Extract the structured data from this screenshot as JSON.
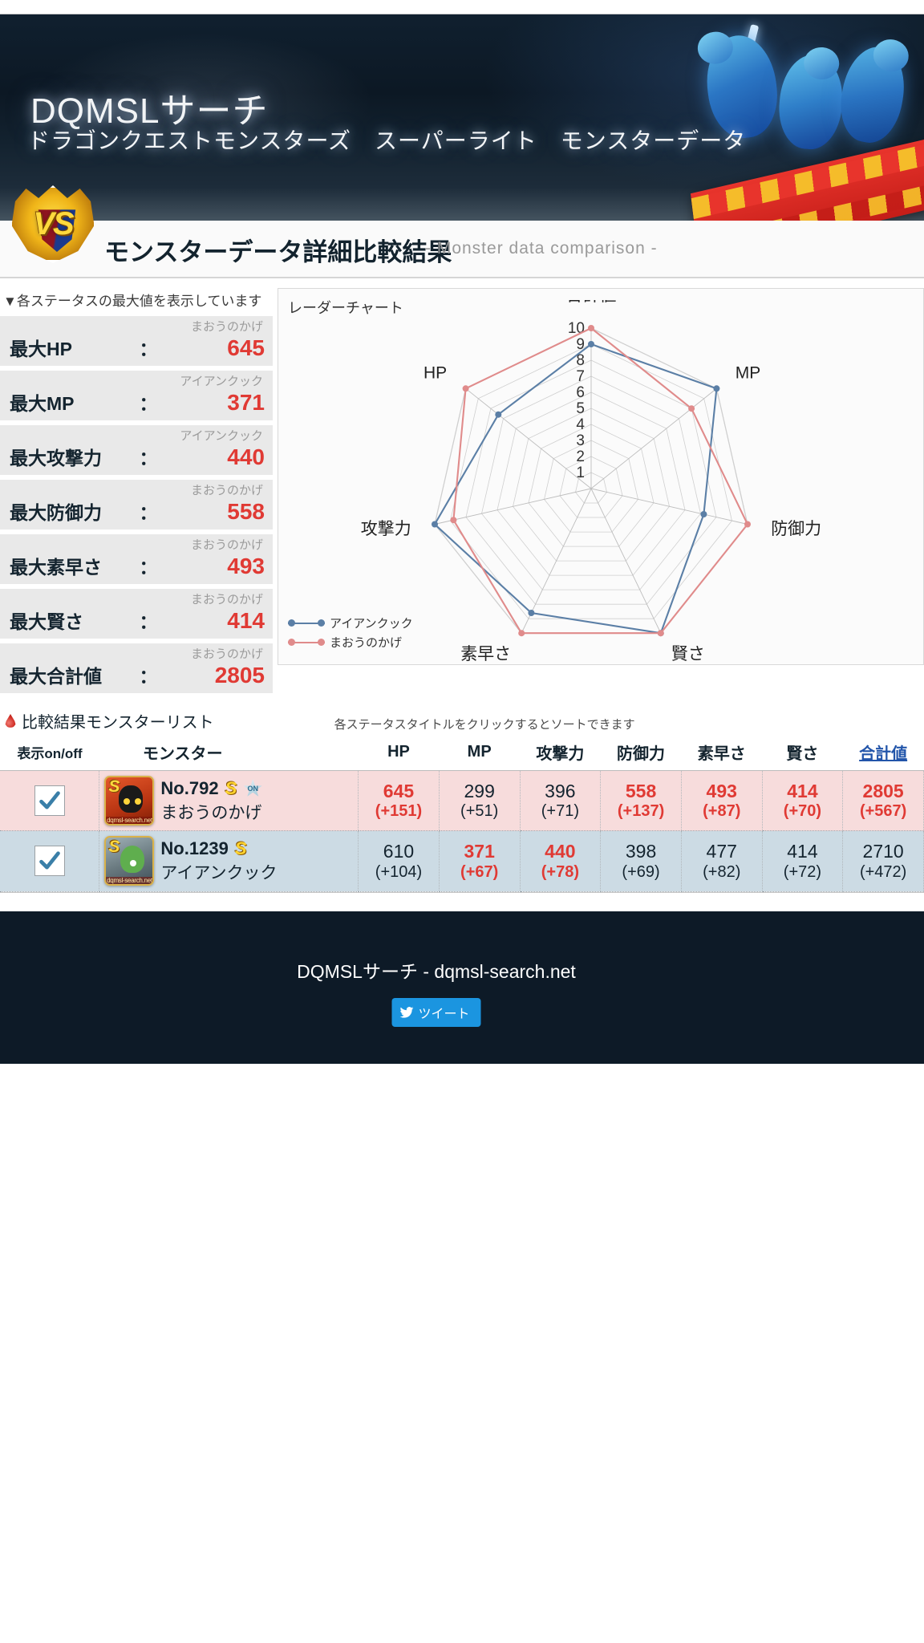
{
  "header": {
    "title": "DQMSLサーチ",
    "subtitle": "ドラゴンクエストモンスターズ　スーパーライト　モンスターデータ"
  },
  "comparison": {
    "badge_text": "VS",
    "title": "モンスターデータ詳細比較結果",
    "subtitle": "- Monster data comparison -"
  },
  "max_stats": {
    "note": "▼各ステータスの最大値を表示しています",
    "colon": "：",
    "rows": [
      {
        "label": "最大HP",
        "owner": "まおうのかげ",
        "value": "645"
      },
      {
        "label": "最大MP",
        "owner": "アイアンクック",
        "value": "371"
      },
      {
        "label": "最大攻撃力",
        "owner": "アイアンクック",
        "value": "440"
      },
      {
        "label": "最大防御力",
        "owner": "まおうのかげ",
        "value": "558"
      },
      {
        "label": "最大素早さ",
        "owner": "まおうのかげ",
        "value": "493"
      },
      {
        "label": "最大賢さ",
        "owner": "まおうのかげ",
        "value": "414"
      },
      {
        "label": "最大合計値",
        "owner": "まおうのかげ",
        "value": "2805"
      }
    ]
  },
  "chart_data": {
    "type": "radar",
    "title": "レーダーチャート",
    "axes": [
      "合計値",
      "MP",
      "防御力",
      "賢さ",
      "素早さ",
      "攻撃力",
      "HP"
    ],
    "tick_labels": [
      "10",
      "9",
      "8",
      "7",
      "6",
      "5",
      "4",
      "3",
      "2",
      "1"
    ],
    "scale_max": 10,
    "scale_min": 1,
    "grid": true,
    "legend_position": "bottom-left",
    "series": [
      {
        "name": "アイアンクック",
        "color": "#5b7fa6",
        "values": {
          "合計値": 9.0,
          "MP": 10.0,
          "防御力": 7.2,
          "賢さ": 10.0,
          "素早さ": 8.6,
          "攻撃力": 10.0,
          "HP": 7.4
        }
      },
      {
        "name": "まおうのかげ",
        "color": "#e08b8b",
        "values": {
          "合計値": 10.0,
          "MP": 8.0,
          "防御力": 10.0,
          "賢さ": 10.0,
          "素早さ": 10.0,
          "攻撃力": 8.8,
          "HP": 10.0
        }
      }
    ]
  },
  "monster_list": {
    "heading": "比較結果モンスターリスト",
    "hint": "各ステータスタイトルをクリックするとソートできます",
    "columns": {
      "toggle": "表示on/off",
      "monster": "モンスター",
      "stats": [
        "HP",
        "MP",
        "攻撃力",
        "防御力",
        "素早さ",
        "賢さ",
        "合計値"
      ],
      "sorted_column": "合計値"
    },
    "rows": [
      {
        "checked": true,
        "no": "No.792",
        "rank_badge": "S",
        "extra_badge": "ON",
        "name": "まおうのかげ",
        "thumb_watermark": "dqmsl-search.net",
        "stats": [
          {
            "value": "645",
            "plus": "(+151)",
            "highlight": true
          },
          {
            "value": "299",
            "plus": "(+51)",
            "highlight": false
          },
          {
            "value": "396",
            "plus": "(+71)",
            "highlight": false
          },
          {
            "value": "558",
            "plus": "(+137)",
            "highlight": true
          },
          {
            "value": "493",
            "plus": "(+87)",
            "highlight": true
          },
          {
            "value": "414",
            "plus": "(+70)",
            "highlight": true
          },
          {
            "value": "2805",
            "plus": "(+567)",
            "highlight": true
          }
        ]
      },
      {
        "checked": true,
        "no": "No.1239",
        "rank_badge": "S",
        "extra_badge": "",
        "name": "アイアンクック",
        "thumb_watermark": "dqmsl-search.net",
        "stats": [
          {
            "value": "610",
            "plus": "(+104)",
            "highlight": false
          },
          {
            "value": "371",
            "plus": "(+67)",
            "highlight": true
          },
          {
            "value": "440",
            "plus": "(+78)",
            "highlight": true
          },
          {
            "value": "398",
            "plus": "(+69)",
            "highlight": false
          },
          {
            "value": "477",
            "plus": "(+82)",
            "highlight": false
          },
          {
            "value": "414",
            "plus": "(+72)",
            "highlight": false
          },
          {
            "value": "2710",
            "plus": "(+472)",
            "highlight": false
          }
        ]
      }
    ]
  },
  "footer": {
    "text": "DQMSLサーチ - dqmsl-search.net",
    "tweet_label": "ツイート"
  },
  "colors": {
    "accent_red": "#e03a34",
    "series_blue": "#5b7fa6",
    "series_pink": "#e08b8b",
    "row_a": "#f7dcdc",
    "row_b": "#ccdbe4"
  }
}
